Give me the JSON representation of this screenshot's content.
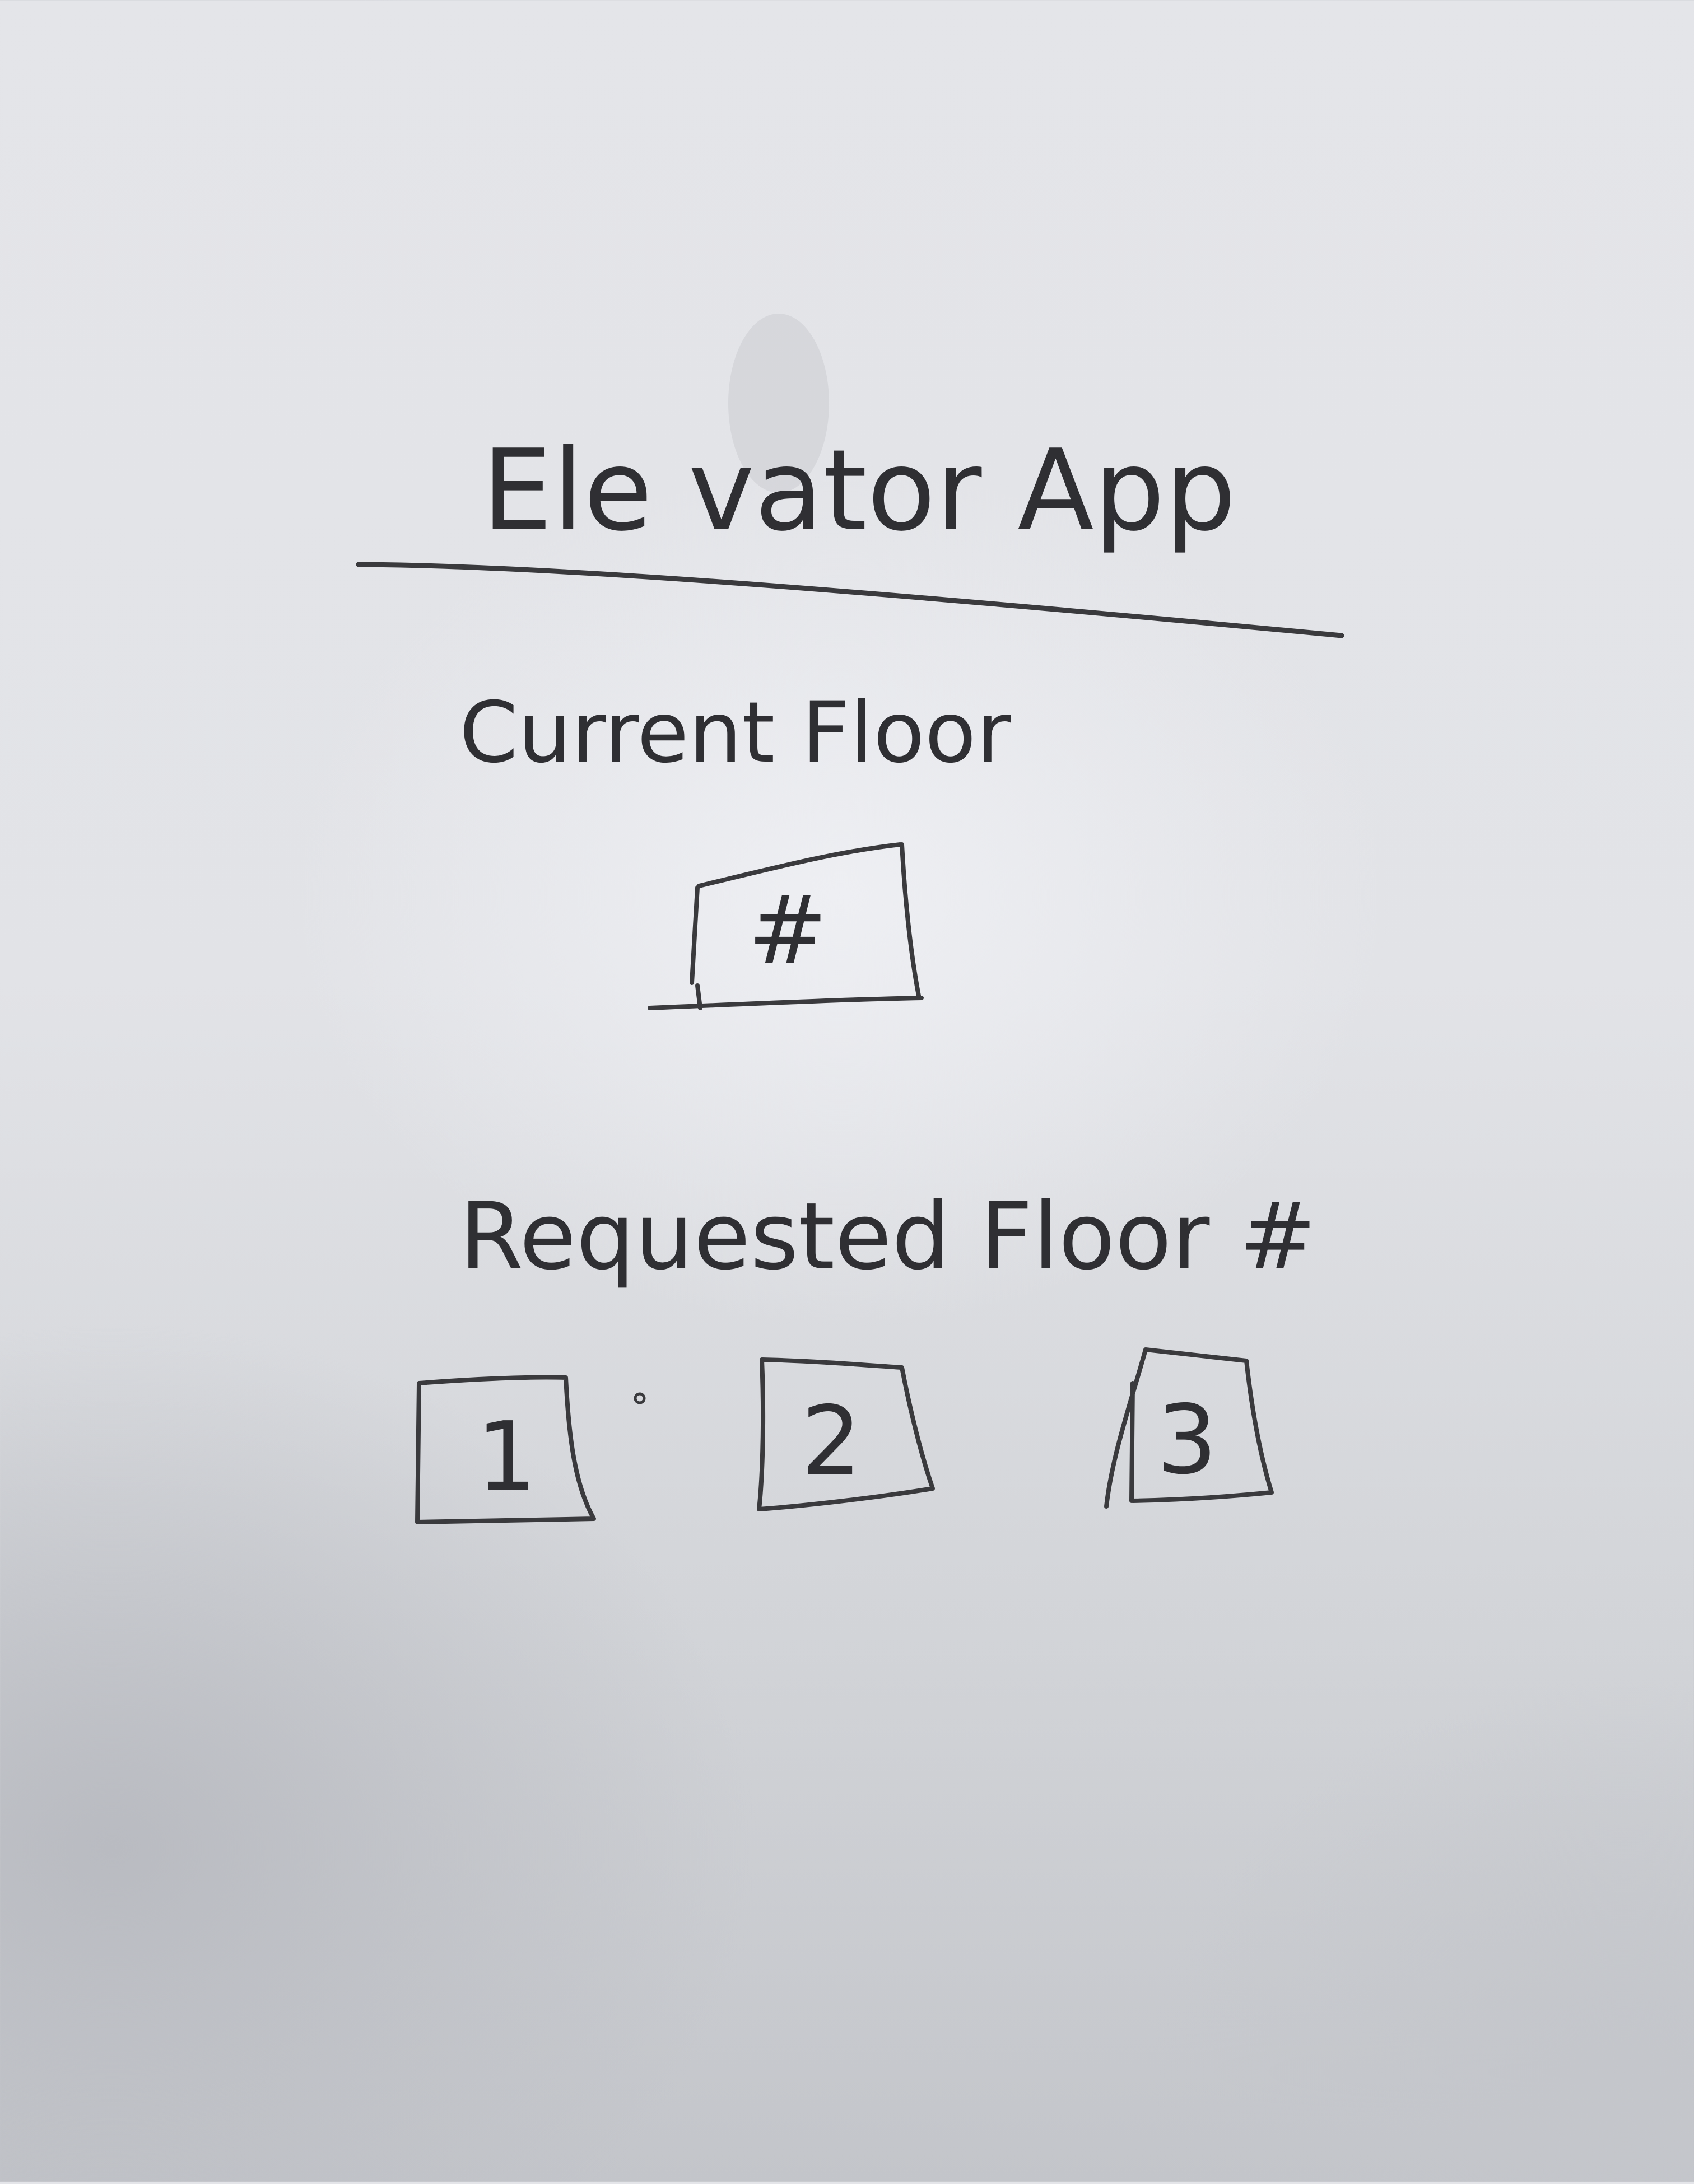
{
  "app": {
    "title": "Ele vator App"
  },
  "current_floor": {
    "label": "Current Floor",
    "display_value": "#"
  },
  "requested_floor": {
    "label": "Requested Floor #",
    "buttons": [
      {
        "label": "1"
      },
      {
        "label": "2"
      },
      {
        "label": "3"
      }
    ]
  },
  "colors": {
    "paper": "#e3e4e8",
    "ink": "#3a3a3d"
  }
}
